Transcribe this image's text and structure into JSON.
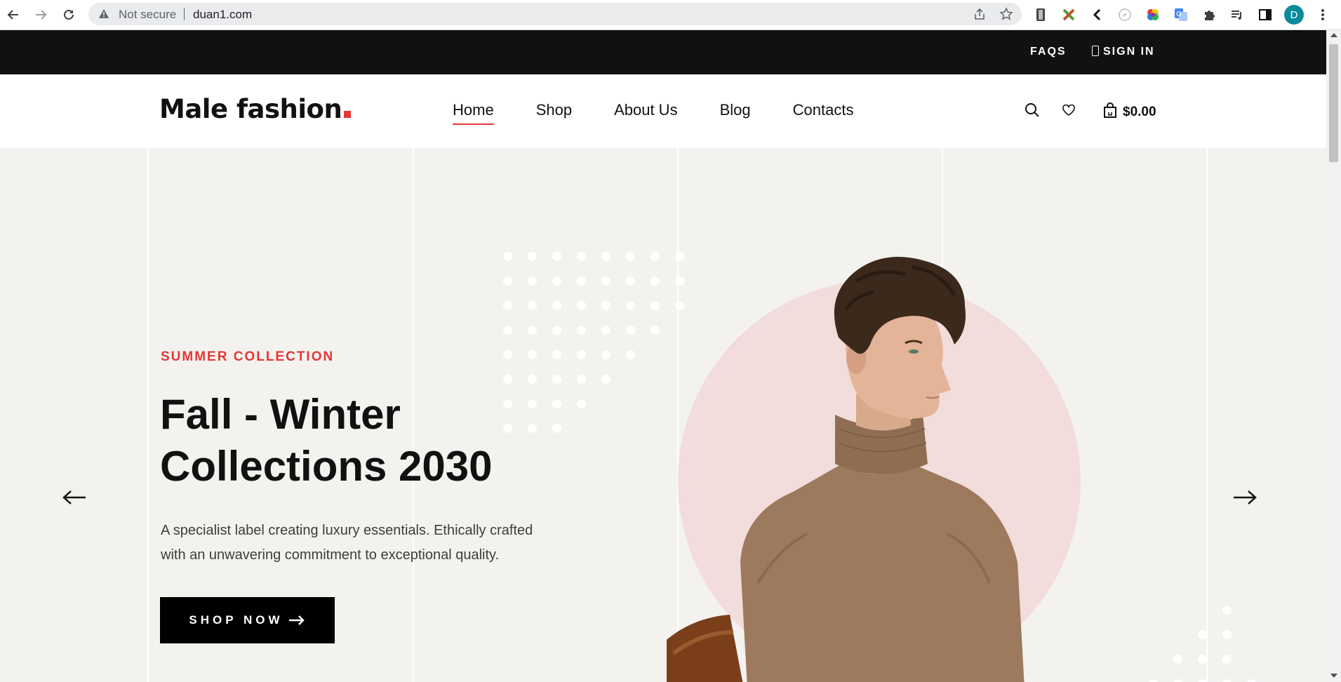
{
  "browser": {
    "security_label": "Not secure",
    "url": "duan1.com",
    "profile_initial": "D"
  },
  "topbar": {
    "faqs": "FAQS",
    "sign_in": "SIGN IN"
  },
  "header": {
    "logo_text": "Male fashion",
    "menu": [
      {
        "label": "Home",
        "active": true
      },
      {
        "label": "Shop",
        "active": false
      },
      {
        "label": "About Us",
        "active": false
      },
      {
        "label": "Blog",
        "active": false
      },
      {
        "label": "Contacts",
        "active": false
      }
    ],
    "cart_total": "$0.00"
  },
  "hero": {
    "kicker": "SUMMER COLLECTION",
    "title": "Fall - Winter Collections 2030",
    "description": "A specialist label creating luxury essentials. Ethically crafted with an unwavering commitment to exceptional quality.",
    "button_label": "SHOP NOW"
  },
  "colors": {
    "accent": "#e53637",
    "topbar_bg": "#111111",
    "hero_bg": "#f3f2ee",
    "circle": "#f2dcdc",
    "sweater": "#9d7a5d"
  },
  "icons": [
    "back-arrow-icon",
    "forward-arrow-icon",
    "reload-icon",
    "warning-icon",
    "share-icon",
    "star-icon",
    "search-icon",
    "heart-icon",
    "bag-icon",
    "arrow-left-icon",
    "arrow-right-icon"
  ]
}
